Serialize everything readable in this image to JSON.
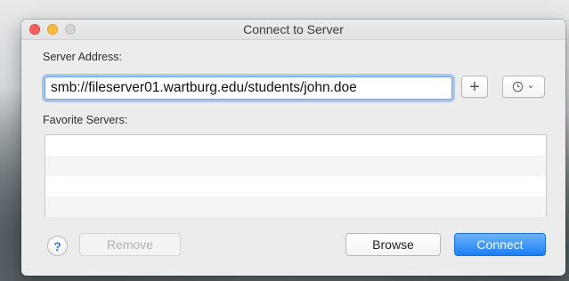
{
  "window": {
    "title": "Connect to Server"
  },
  "server_address": {
    "label": "Server Address:",
    "value": "smb://fileserver01.wartburg.edu/students/john.doe",
    "add_button_label": "+",
    "recent_button_icon": "clock-icon",
    "recent_button_chevron": "⌄"
  },
  "favorites": {
    "label": "Favorite Servers:",
    "rows": [
      "",
      "",
      "",
      ""
    ]
  },
  "buttons": {
    "help_label": "?",
    "remove_label": "Remove",
    "browse_label": "Browse",
    "connect_label": "Connect"
  },
  "colors": {
    "accent": "#1b7ff5",
    "close": "#fc605c",
    "minimize": "#fdbc40",
    "zoom_disabled": "#d4d4d4"
  }
}
